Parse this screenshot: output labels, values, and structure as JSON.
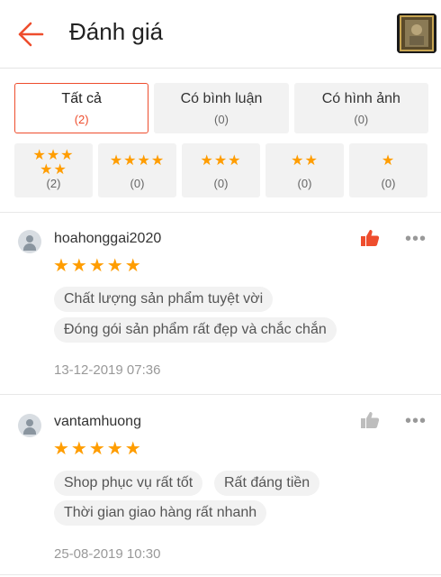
{
  "header": {
    "title": "Đánh giá",
    "back_icon": "arrow-left-icon",
    "accent": "#ee4d2d"
  },
  "filters": {
    "tabs": [
      {
        "label": "Tất cả",
        "count": "(2)",
        "active": true
      },
      {
        "label": "Có bình luận",
        "count": "(0)"
      },
      {
        "label": "Có hình ảnh",
        "count": "(0)"
      }
    ],
    "star_filters": [
      {
        "stars": "★★★★★",
        "count": "(2)"
      },
      {
        "stars": "★★★★",
        "count": "(0)"
      },
      {
        "stars": "★★★",
        "count": "(0)"
      },
      {
        "stars": "★★",
        "count": "(0)"
      },
      {
        "stars": "★",
        "count": "(0)"
      }
    ]
  },
  "reviews": [
    {
      "username": "hoahonggai2020",
      "rating": "★★★★★",
      "tags": [
        "Chất lượng sản phẩm tuyệt vời",
        "Đóng gói sản phẩm rất đẹp và chắc chắn"
      ],
      "date": "13-12-2019 07:36",
      "liked": true
    },
    {
      "username": "vantamhuong",
      "rating": "★★★★★",
      "tags": [
        "Shop phục vụ rất tốt",
        "Rất đáng tiền",
        "Thời gian giao hàng rất nhanh"
      ],
      "date": "25-08-2019 10:30",
      "liked": false
    }
  ],
  "colors": {
    "star": "#ff9d00",
    "like_active": "#ee4d2d",
    "like_inactive": "#bdbdbd"
  }
}
